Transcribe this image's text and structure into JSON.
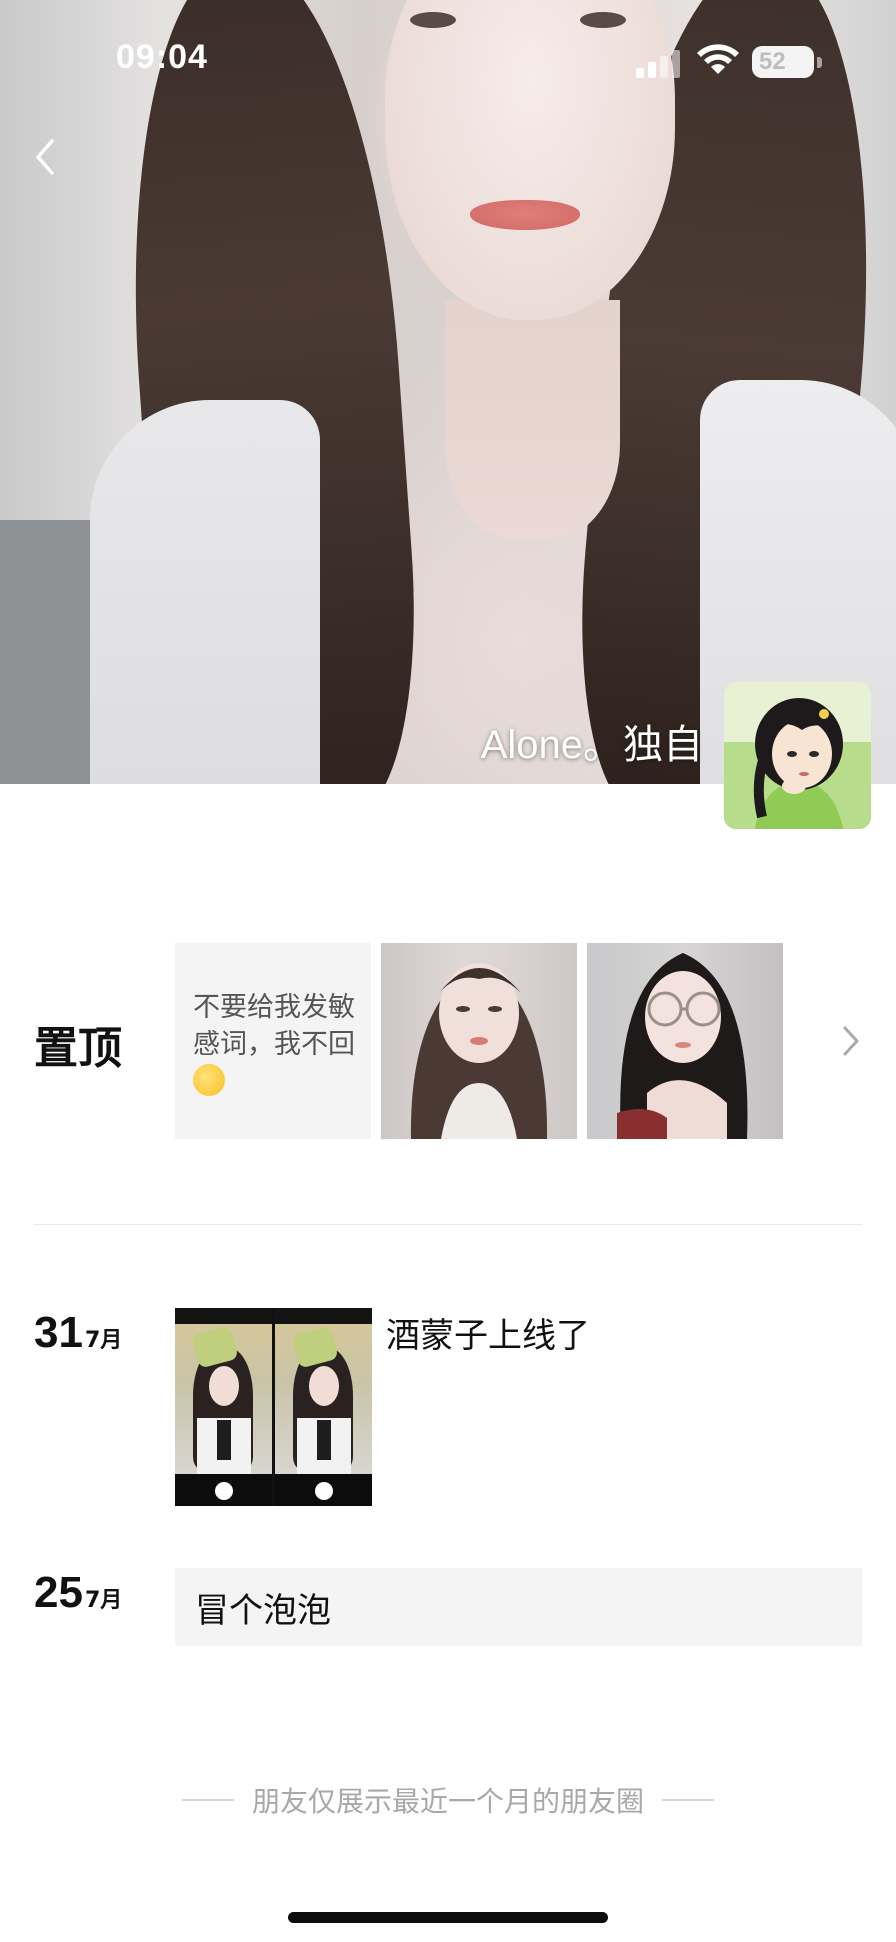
{
  "status_bar": {
    "time": "09:04",
    "battery": "52",
    "icons": [
      "cellular-signal-icon",
      "wifi-icon",
      "battery-icon"
    ]
  },
  "nav": {
    "back_icon": "chevron-left-icon"
  },
  "profile": {
    "nickname": "Alone。独自"
  },
  "pinned": {
    "label": "置顶",
    "text_post": "不要给我发敏感词，我不回",
    "more_icon": "chevron-right-icon"
  },
  "posts": [
    {
      "day": "31",
      "month": "7月",
      "text": "酒蒙子上线了"
    },
    {
      "day": "25",
      "month": "7月",
      "text": "冒个泡泡"
    }
  ],
  "footer": {
    "note": "朋友仅展示最近一个月的朋友圈"
  },
  "colors": {
    "text_primary": "#111111",
    "text_muted": "#a8a8a8",
    "card_bg": "#f4f4f4"
  }
}
